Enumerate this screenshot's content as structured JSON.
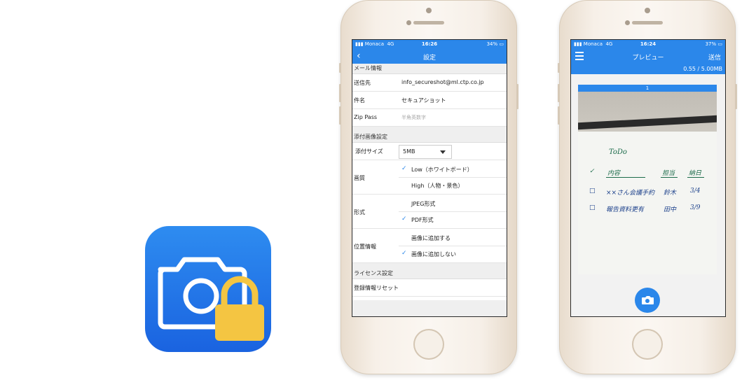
{
  "colors": {
    "accent": "#2b87ea",
    "icon_lock": "#f4c542",
    "icon_bg": "#1a63e0"
  },
  "app_icon": {
    "icon": "camera-lock-icon"
  },
  "settings_screen": {
    "status": {
      "carrier": "Monaca",
      "network": "4G",
      "time": "16:26",
      "battery": "34%"
    },
    "nav": {
      "back_icon": "chevron-left-icon",
      "title": "設定"
    },
    "mail_section": {
      "header": "メール情報",
      "rows": [
        {
          "label": "送信先",
          "value": "info_secureshot@ml.ctp.co.jp"
        },
        {
          "label": "件名",
          "value": "セキュアショット"
        },
        {
          "label": "Zip Pass",
          "placeholder": "半角英数字"
        }
      ]
    },
    "attach_section": {
      "header": "添付画像設定",
      "size_label": "添付サイズ",
      "size_value": "5MB",
      "quality_label": "画質",
      "quality_options": [
        {
          "label": "Low（ホワイトボード）",
          "checked": true
        },
        {
          "label": "High（人物・景色）",
          "checked": false
        }
      ],
      "format_label": "形式",
      "format_options": [
        {
          "label": "JPEG形式",
          "checked": false
        },
        {
          "label": "PDF形式",
          "checked": true
        }
      ],
      "location_label": "位置情報",
      "location_options": [
        {
          "label": "画像に追加する",
          "checked": false
        },
        {
          "label": "画像に追加しない",
          "checked": true
        }
      ]
    },
    "license_section": {
      "header": "ライセンス設定",
      "reset_label": "登録情報リセット"
    }
  },
  "preview_screen": {
    "status": {
      "carrier": "Monaca",
      "network": "4G",
      "time": "16:24",
      "battery": "37%"
    },
    "nav": {
      "menu_icon": "hamburger-menu-icon",
      "title": "プレビュー",
      "send_label": "送信"
    },
    "size_info": "0.55 / 5.00MB",
    "page_label": "1",
    "camera_button_icon": "camera-icon",
    "whiteboard": {
      "title": "ToDo",
      "headers": [
        "内容",
        "担当",
        "納日"
      ],
      "rows": [
        {
          "task": "××さん会議手約",
          "owner": "鈴木",
          "due": "3/4"
        },
        {
          "task": "報告資料更有",
          "owner": "田中",
          "due": "3/9"
        }
      ]
    }
  }
}
